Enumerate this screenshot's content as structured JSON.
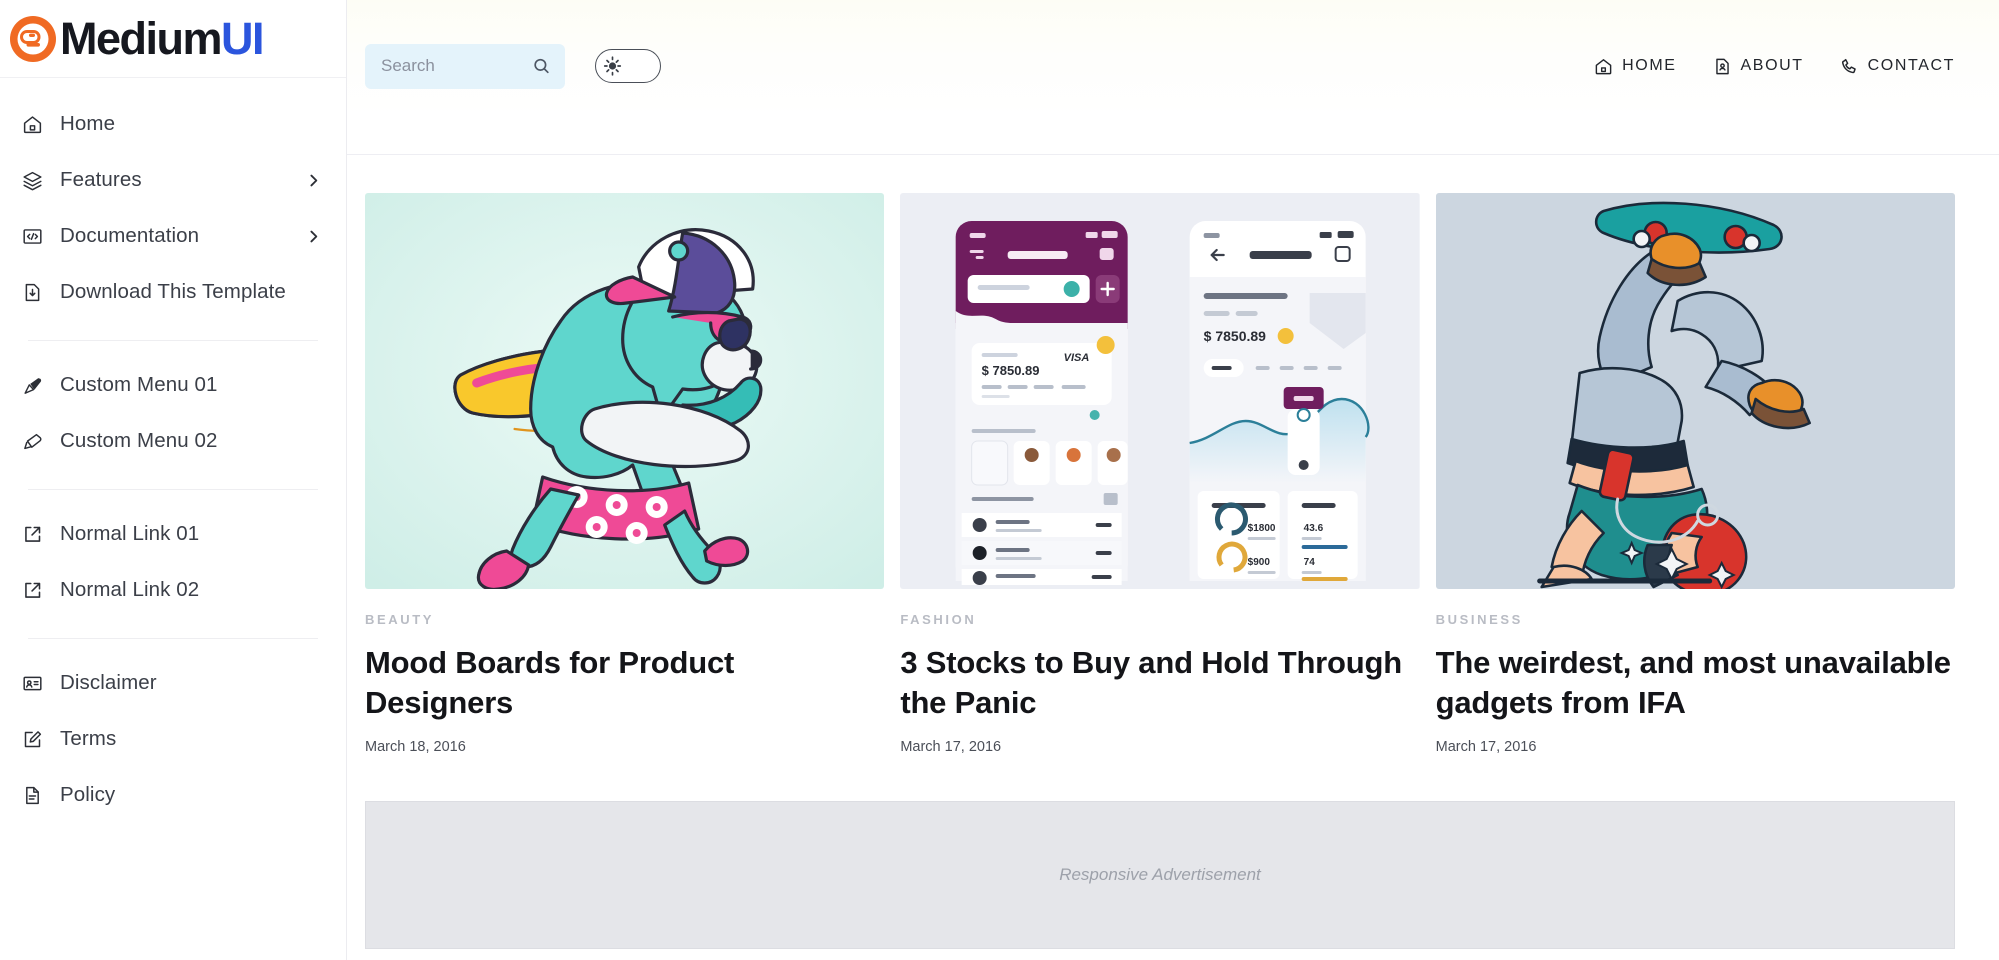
{
  "brand": {
    "name_primary": "Medium",
    "name_accent": "UI",
    "logo_icon": "blogger-b-icon",
    "accent_color": "#2b55dd",
    "logo_color": "#f06a23"
  },
  "sidebar": {
    "groups": [
      {
        "items": [
          {
            "label": "Home",
            "icon": "home-icon",
            "caret": false
          },
          {
            "label": "Features",
            "icon": "layers-icon",
            "caret": true
          },
          {
            "label": "Documentation",
            "icon": "code-window-icon",
            "caret": true
          },
          {
            "label": "Download This Template",
            "icon": "file-download-icon",
            "caret": false
          }
        ]
      },
      {
        "items": [
          {
            "label": "Custom Menu 01",
            "icon": "ink-pen-icon",
            "caret": false
          },
          {
            "label": "Custom Menu 02",
            "icon": "paint-bucket-icon",
            "caret": false
          }
        ]
      },
      {
        "items": [
          {
            "label": "Normal Link 01",
            "icon": "external-link-icon",
            "caret": false
          },
          {
            "label": "Normal Link 02",
            "icon": "external-link-icon",
            "caret": false
          }
        ]
      },
      {
        "items": [
          {
            "label": "Disclaimer",
            "icon": "id-card-icon",
            "caret": false
          },
          {
            "label": "Terms",
            "icon": "edit-square-icon",
            "caret": false
          },
          {
            "label": "Policy",
            "icon": "document-text-icon",
            "caret": false
          }
        ]
      }
    ]
  },
  "topbar": {
    "search": {
      "placeholder": "Search",
      "value": "",
      "icon": "search-icon"
    },
    "theme_toggle": {
      "state": "light",
      "icon": "sun-icon"
    },
    "nav": [
      {
        "label": "HOME",
        "icon": "home-icon"
      },
      {
        "label": "ABOUT",
        "icon": "profile-card-icon"
      },
      {
        "label": "CONTACT",
        "icon": "phone-icon"
      }
    ]
  },
  "posts": [
    {
      "category": "BEAUTY",
      "title": "Mood Boards for Product Designers",
      "date": "March 18, 2016",
      "thumb": "surfing-bear-illustration"
    },
    {
      "category": "FASHION",
      "title": "3 Stocks to Buy and Hold Through the Panic",
      "date": "March 17, 2016",
      "thumb": "wallet-dashboard-app-mockup"
    },
    {
      "category": "BUSINESS",
      "title": "The weirdest, and most unavailable gadgets from IFA",
      "date": "March 17, 2016",
      "thumb": "skateboarder-handstand-illustration"
    }
  ],
  "ad": {
    "label": "Responsive Advertisement"
  }
}
